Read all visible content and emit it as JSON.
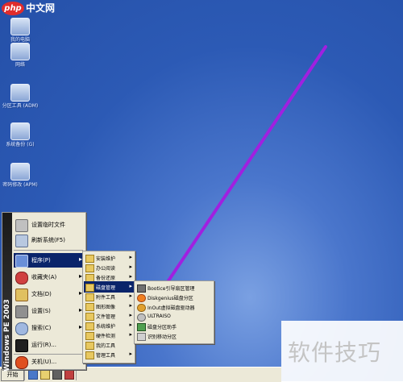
{
  "site_logo": {
    "badge": "php",
    "text": "中文网"
  },
  "desktop_icons": [
    {
      "label": "我的电脑"
    },
    {
      "label": "网络"
    },
    {
      "label": "分区工具 (ADM)"
    },
    {
      "label": "系统备份 (G)"
    },
    {
      "label": "密码修改 (APM)"
    }
  ],
  "start_menu": {
    "brand": "Windows PE 2003",
    "items": [
      {
        "label": "设置临时文件"
      },
      {
        "label": "刷新系统(F5)"
      },
      {
        "label": "程序(P)",
        "has_submenu": true,
        "selected": true
      },
      {
        "label": "收藏夹(A)",
        "has_submenu": true
      },
      {
        "label": "文档(D)",
        "has_submenu": true
      },
      {
        "label": "设置(S)",
        "has_submenu": true
      },
      {
        "label": "搜索(C)",
        "has_submenu": true
      },
      {
        "label": "运行(R)..."
      },
      {
        "label": "关机(U)..."
      }
    ]
  },
  "programs_menu": {
    "items": [
      {
        "label": "安装维护"
      },
      {
        "label": "办公阅读"
      },
      {
        "label": "备份还原"
      },
      {
        "label": "磁盘管理",
        "selected": true
      },
      {
        "label": "附件工具"
      },
      {
        "label": "图形图像"
      },
      {
        "label": "文件管理"
      },
      {
        "label": "系统维护"
      },
      {
        "label": "硬件检测"
      },
      {
        "label": "我的工具"
      },
      {
        "label": "管理工具"
      }
    ]
  },
  "disk_menu": {
    "items": [
      {
        "label": "Bootice引导扇区管理"
      },
      {
        "label": "Diskgenius磁盘分区"
      },
      {
        "label": "InOut虚拟磁盘驱动器"
      },
      {
        "label": "ULTRAISO"
      },
      {
        "label": "磁盘分区助手"
      },
      {
        "label": "识别移动分区"
      }
    ]
  },
  "taskbar": {
    "start_label": "开始"
  },
  "watermark": {
    "text": "软件技巧"
  },
  "colors": {
    "desktop": "#2c5ab5",
    "menu_bg": "#ece9d8",
    "highlight": "#0a246a",
    "arrow": "#a020e0"
  }
}
